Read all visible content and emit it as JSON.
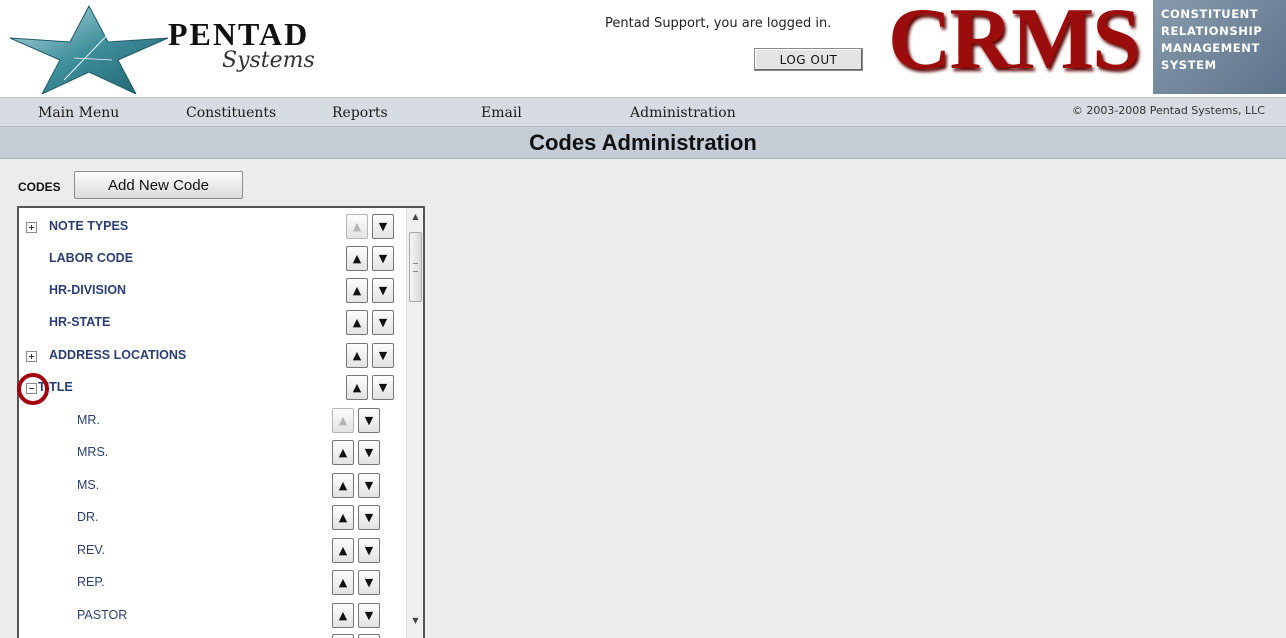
{
  "header": {
    "logo": {
      "word": "PENTAD",
      "sub": "Systems"
    },
    "login_message": "Pentad Support, you are logged in.",
    "logout_label": "LOG OUT",
    "crms_logo": "CRMS",
    "crms_tagline": [
      "CONSTITUENT",
      "RELATIONSHIP",
      "MANAGEMENT",
      "SYSTEM"
    ],
    "accent_color": "#9b0c0c"
  },
  "nav": {
    "items": [
      {
        "label": "Main Menu"
      },
      {
        "label": "Constituents"
      },
      {
        "label": "Reports"
      },
      {
        "label": "Email"
      },
      {
        "label": "Administration"
      }
    ],
    "copyright": "© 2003-2008 Pentad Systems, LLC"
  },
  "page": {
    "title": "Codes Administration"
  },
  "codes": {
    "label": "CODES",
    "add_button": "Add New Code",
    "rows": [
      {
        "label": "NOTE TYPES",
        "toggle": "expand",
        "up_enabled": false
      },
      {
        "label": "LABOR CODE",
        "toggle": "none",
        "up_enabled": true
      },
      {
        "label": "HR-DIVISION",
        "toggle": "none",
        "up_enabled": true
      },
      {
        "label": "HR-STATE",
        "toggle": "none",
        "up_enabled": true
      },
      {
        "label": "ADDRESS LOCATIONS",
        "toggle": "expand",
        "up_enabled": true
      },
      {
        "label": "TITLE",
        "toggle": "collapse",
        "up_enabled": true
      }
    ],
    "title_children": [
      {
        "label": "MR.",
        "up_enabled": false
      },
      {
        "label": "MRS.",
        "up_enabled": true
      },
      {
        "label": "MS.",
        "up_enabled": true
      },
      {
        "label": "DR.",
        "up_enabled": true
      },
      {
        "label": "REV.",
        "up_enabled": true
      },
      {
        "label": "REP.",
        "up_enabled": true
      },
      {
        "label": "PASTOR",
        "up_enabled": true
      }
    ]
  },
  "icons": {
    "up_arrow": "▲",
    "down_arrow": "▼",
    "scroll_up": "▲",
    "scroll_down": "▼"
  }
}
